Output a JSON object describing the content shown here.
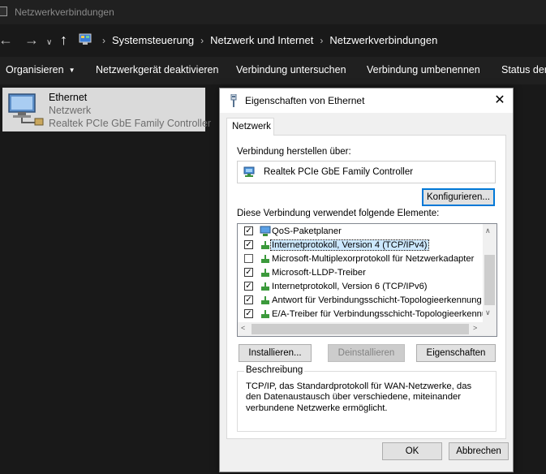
{
  "window": {
    "title": "Netzwerkverbindungen"
  },
  "address": {
    "breadcrumbs": [
      "Systemsteuerung",
      "Netzwerk und Internet",
      "Netzwerkverbindungen"
    ],
    "separator": "›"
  },
  "commands": {
    "organize": "Organisieren",
    "disable": "Netzwerkgerät deaktivieren",
    "diagnose": "Verbindung untersuchen",
    "rename": "Verbindung umbenennen",
    "status": "Status der"
  },
  "connection": {
    "name": "Ethernet",
    "status": "Netzwerk",
    "device": "Realtek PCIe GbE Family Controller"
  },
  "dialog": {
    "title": "Eigenschaften von Ethernet",
    "close": "✕",
    "tab": "Netzwerk",
    "connect_using_label": "Verbindung herstellen über:",
    "adapter": "Realtek PCIe GbE Family Controller",
    "configure_button": "Konfigurieren...",
    "items_label": "Diese Verbindung verwendet folgende Elemente:",
    "items": [
      {
        "label": "QoS-Paketplaner",
        "checked": true,
        "icon": "network-service-icon",
        "selected": false
      },
      {
        "label": "Internetprotokoll, Version 4 (TCP/IPv4)",
        "checked": true,
        "icon": "network-protocol-icon",
        "selected": true
      },
      {
        "label": "Microsoft-Multiplexorprotokoll für Netzwerkadapter",
        "checked": false,
        "icon": "network-protocol-icon",
        "selected": false
      },
      {
        "label": "Microsoft-LLDP-Treiber",
        "checked": true,
        "icon": "network-protocol-icon",
        "selected": false
      },
      {
        "label": "Internetprotokoll, Version 6 (TCP/IPv6)",
        "checked": true,
        "icon": "network-protocol-icon",
        "selected": false
      },
      {
        "label": "Antwort für Verbindungsschicht-Topologieerkennung",
        "checked": true,
        "icon": "network-protocol-icon",
        "selected": false
      },
      {
        "label": "E/A-Treiber für Verbindungsschicht-Topologieerkennung",
        "checked": true,
        "icon": "network-protocol-icon",
        "selected": false
      }
    ],
    "install_button": "Installieren...",
    "uninstall_button": "Deinstallieren",
    "properties_button": "Eigenschaften",
    "description_legend": "Beschreibung",
    "description_text": "TCP/IP, das Standardprotokoll für WAN-Netzwerke, das den Datenaustausch über verschiedene, miteinander verbundene Netzwerke ermöglicht.",
    "ok_button": "OK",
    "cancel_button": "Abbrechen"
  },
  "colors": {
    "explorer_bg": "#191919",
    "selection": "#cce8ff",
    "focus_border": "#0078d7"
  }
}
